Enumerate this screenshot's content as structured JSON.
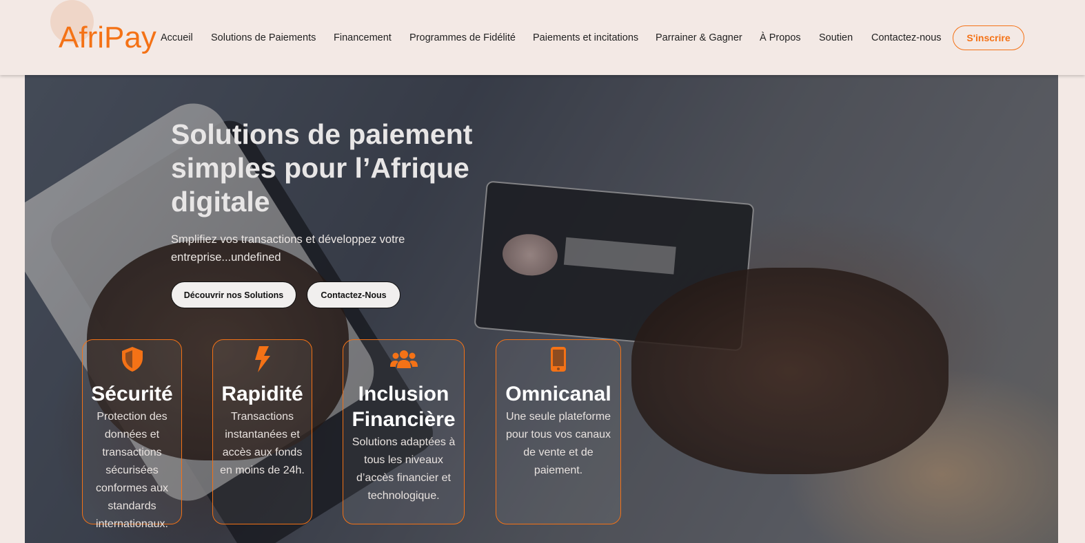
{
  "brand": {
    "name": "AfriPay",
    "accent": "#f47216"
  },
  "nav": {
    "items": [
      "Accueil",
      "Solutions de Paiements",
      "Financement",
      "Programmes de Fidélité",
      "Paiements et incitations",
      "Parrainer & Gagner",
      "À Propos",
      "Soutien",
      "Contactez-nous"
    ],
    "signup_label": "S'inscrire"
  },
  "hero": {
    "title": "Solutions de paiement simples pour l’Afrique digitale",
    "subtitle": "Smplifiez vos transactions et développez votre entreprise...undefined",
    "primary_button": "Découvrir nos Solutions",
    "secondary_button": "Contactez-Nous"
  },
  "features": [
    {
      "icon": "shield-icon",
      "title": "Sécurité",
      "text": "Protection des données et transactions sécurisées conformes aux standards internationaux."
    },
    {
      "icon": "bolt-icon",
      "title": "Rapidité",
      "text": "Transactions instantanées et accès aux fonds en moins de 24h."
    },
    {
      "icon": "users-icon",
      "title": "Inclusion Financière",
      "text": "Solutions adaptées à tous les niveaux d’accès financier et technologique."
    },
    {
      "icon": "mobile-icon",
      "title": "Omnicanal",
      "text": "Une seule plateforme pour tous vos canaux de vente et de paiement."
    }
  ]
}
